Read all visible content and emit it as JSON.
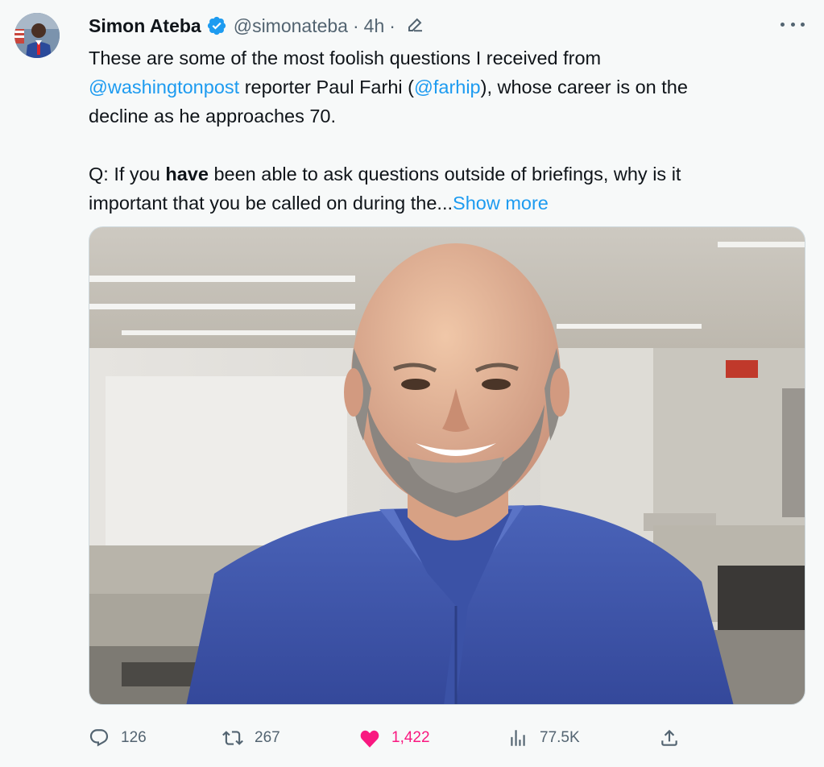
{
  "author": {
    "name": "Simon Ateba",
    "handle": "@simonateba",
    "separator": "·",
    "time": "4h",
    "time_separator": "·",
    "verified_icon": "verified-badge-icon",
    "edited_icon": "edit-pencil-icon"
  },
  "tweet": {
    "line1": "These are some of the most foolish questions I received from",
    "mention_wapo": "@washingtonpost",
    "line2_mid": " reporter Paul Farhi (",
    "mention_farhip": "@farhip",
    "line2_end": "), whose career is on the",
    "line3": "decline as he approaches 70.",
    "q_prefix": "Q: If you ",
    "q_bold": "have",
    "q_rest1": " been able to ask questions outside of briefings, why is it",
    "q_rest2": "important that you be called on during the...",
    "show_more": "Show more"
  },
  "actions": {
    "replies": "126",
    "retweets": "267",
    "likes": "1,422",
    "views": "77.5K"
  },
  "colors": {
    "accent": "#1d9bf0",
    "like": "#f91880",
    "muted": "#536471",
    "background": "#f7f9f9"
  }
}
